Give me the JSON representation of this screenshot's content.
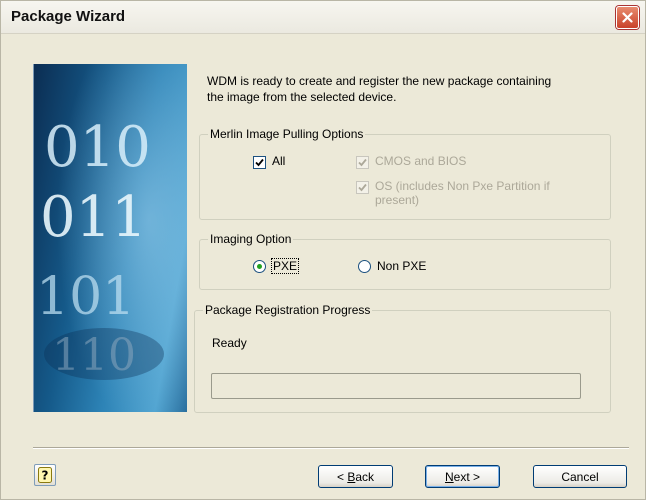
{
  "window": {
    "title": "Package Wizard"
  },
  "intro_text": "WDM is ready to create and register the new package containing the image from the selected device.",
  "banner": {
    "digits_row1": "010",
    "digits_row2": "011",
    "digits_row3": "101",
    "digits_row4": "110"
  },
  "merlin_options": {
    "legend": "Merlin Image Pulling Options",
    "all": {
      "label": "All",
      "checked": true
    },
    "cmos": {
      "label": "CMOS and BIOS",
      "checked": true,
      "disabled": true
    },
    "os": {
      "label_line1": "OS (includes Non Pxe Partition if",
      "label_line2": "present)",
      "checked": true,
      "disabled": true
    }
  },
  "imaging_option": {
    "legend": "Imaging Option",
    "pxe": {
      "label": "PXE",
      "selected": true
    },
    "non_pxe": {
      "label": "Non PXE",
      "selected": false
    }
  },
  "registration": {
    "legend": "Package Registration Progress",
    "status": "Ready",
    "progress": 0
  },
  "buttons": {
    "back": {
      "prefix": "< ",
      "accel": "B",
      "rest": "ack"
    },
    "next": {
      "accel": "N",
      "rest": "ext >"
    },
    "cancel": "Cancel"
  },
  "colors": {
    "accent": "#1c5180",
    "titlebar": "#ebe9e0",
    "dialog_bg": "#ece9d8",
    "close": "#c9412a"
  }
}
